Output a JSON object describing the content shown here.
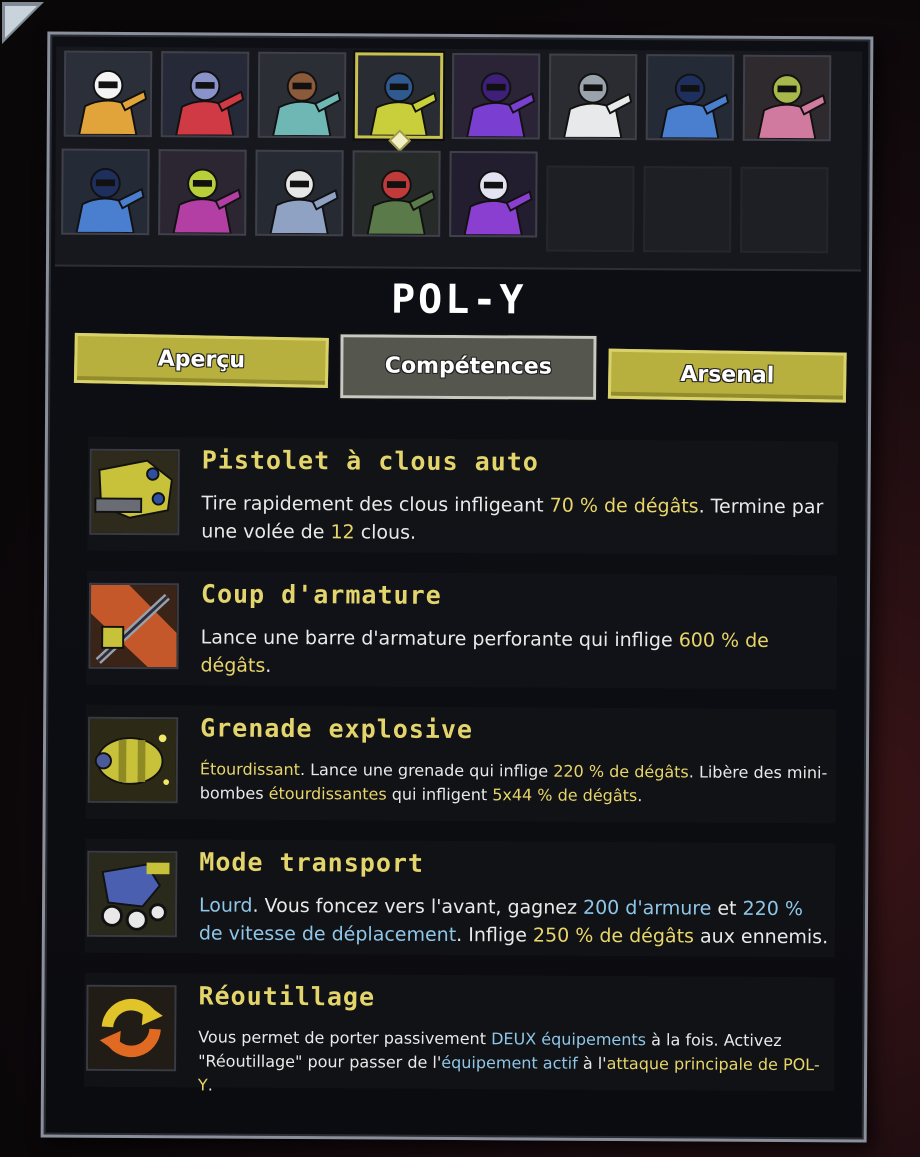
{
  "character": {
    "name": "POL-Y"
  },
  "roster": {
    "slots": [
      {
        "name": "roster-slot-1",
        "tone": "orange"
      },
      {
        "name": "roster-slot-2",
        "tone": "red"
      },
      {
        "name": "roster-slot-3",
        "tone": "teal"
      },
      {
        "name": "roster-slot-4",
        "tone": "yellow",
        "selected": true
      },
      {
        "name": "roster-slot-5",
        "tone": "purple"
      },
      {
        "name": "roster-slot-6",
        "tone": "white"
      },
      {
        "name": "roster-slot-7",
        "tone": "blue"
      },
      {
        "name": "roster-slot-8",
        "tone": "pink"
      },
      {
        "name": "roster-slot-9",
        "tone": "blue"
      },
      {
        "name": "roster-slot-10",
        "tone": "magenta"
      },
      {
        "name": "roster-slot-11",
        "tone": "slate"
      },
      {
        "name": "roster-slot-12",
        "tone": "green"
      },
      {
        "name": "roster-slot-13",
        "tone": "violet"
      },
      {
        "name": "roster-slot-14",
        "tone": "empty"
      },
      {
        "name": "roster-slot-15",
        "tone": "empty"
      },
      {
        "name": "roster-slot-16",
        "tone": "empty"
      }
    ]
  },
  "tabs": {
    "overview": "Aperçu",
    "skills": "Compétences",
    "arsenal": "Arsenal",
    "active": "skills"
  },
  "skills": [
    {
      "icon": "nail-gun-icon",
      "title": "Pistolet à clous auto",
      "desc": [
        {
          "t": "Tire rapidement des clous infligeant "
        },
        {
          "t": "70 % de dégâts",
          "c": "y"
        },
        {
          "t": ". Termine par une volée de "
        },
        {
          "t": "12",
          "c": "y"
        },
        {
          "t": " clous."
        }
      ]
    },
    {
      "icon": "rebar-icon",
      "title": "Coup d'armature",
      "desc": [
        {
          "t": "Lance une barre d'armature perforante qui inflige "
        },
        {
          "t": "600 % de dégâts",
          "c": "y"
        },
        {
          "t": "."
        }
      ]
    },
    {
      "icon": "grenade-icon",
      "title": "Grenade explosive",
      "small": true,
      "desc": [
        {
          "t": "Étourdissant",
          "c": "y"
        },
        {
          "t": ". Lance une grenade qui inflige "
        },
        {
          "t": "220 % de dégâts",
          "c": "y"
        },
        {
          "t": ". Libère des mini-bombes "
        },
        {
          "t": "étourdissantes",
          "c": "y"
        },
        {
          "t": " qui infligent "
        },
        {
          "t": "5x44 % de dégâts",
          "c": "y"
        },
        {
          "t": "."
        }
      ]
    },
    {
      "icon": "transport-mode-icon",
      "title": "Mode transport",
      "desc": [
        {
          "t": "Lourd",
          "c": "b"
        },
        {
          "t": ". Vous foncez vers l'avant, gagnez "
        },
        {
          "t": "200 d'armure",
          "c": "b"
        },
        {
          "t": " et "
        },
        {
          "t": "220 % de vitesse de déplacement",
          "c": "b"
        },
        {
          "t": ". Inflige "
        },
        {
          "t": "250 % de dégâts",
          "c": "y"
        },
        {
          "t": " aux ennemis."
        }
      ]
    },
    {
      "icon": "retool-icon",
      "title": "Réoutillage",
      "small": true,
      "desc": [
        {
          "t": "Vous permet de porter passivement "
        },
        {
          "t": "DEUX équipements",
          "c": "b"
        },
        {
          "t": " à la fois. Activez \"Réoutillage\" pour passer de l'"
        },
        {
          "t": "équipement actif",
          "c": "b"
        },
        {
          "t": " à l'"
        },
        {
          "t": "attaque principale de POL-Y",
          "c": "y"
        },
        {
          "t": "."
        }
      ]
    }
  ],
  "colors": {
    "accent_yellow": "#e8d56a",
    "accent_blue": "#8fc6e8",
    "tab_inactive": "#b8b03e",
    "tab_active": "#55574f"
  }
}
